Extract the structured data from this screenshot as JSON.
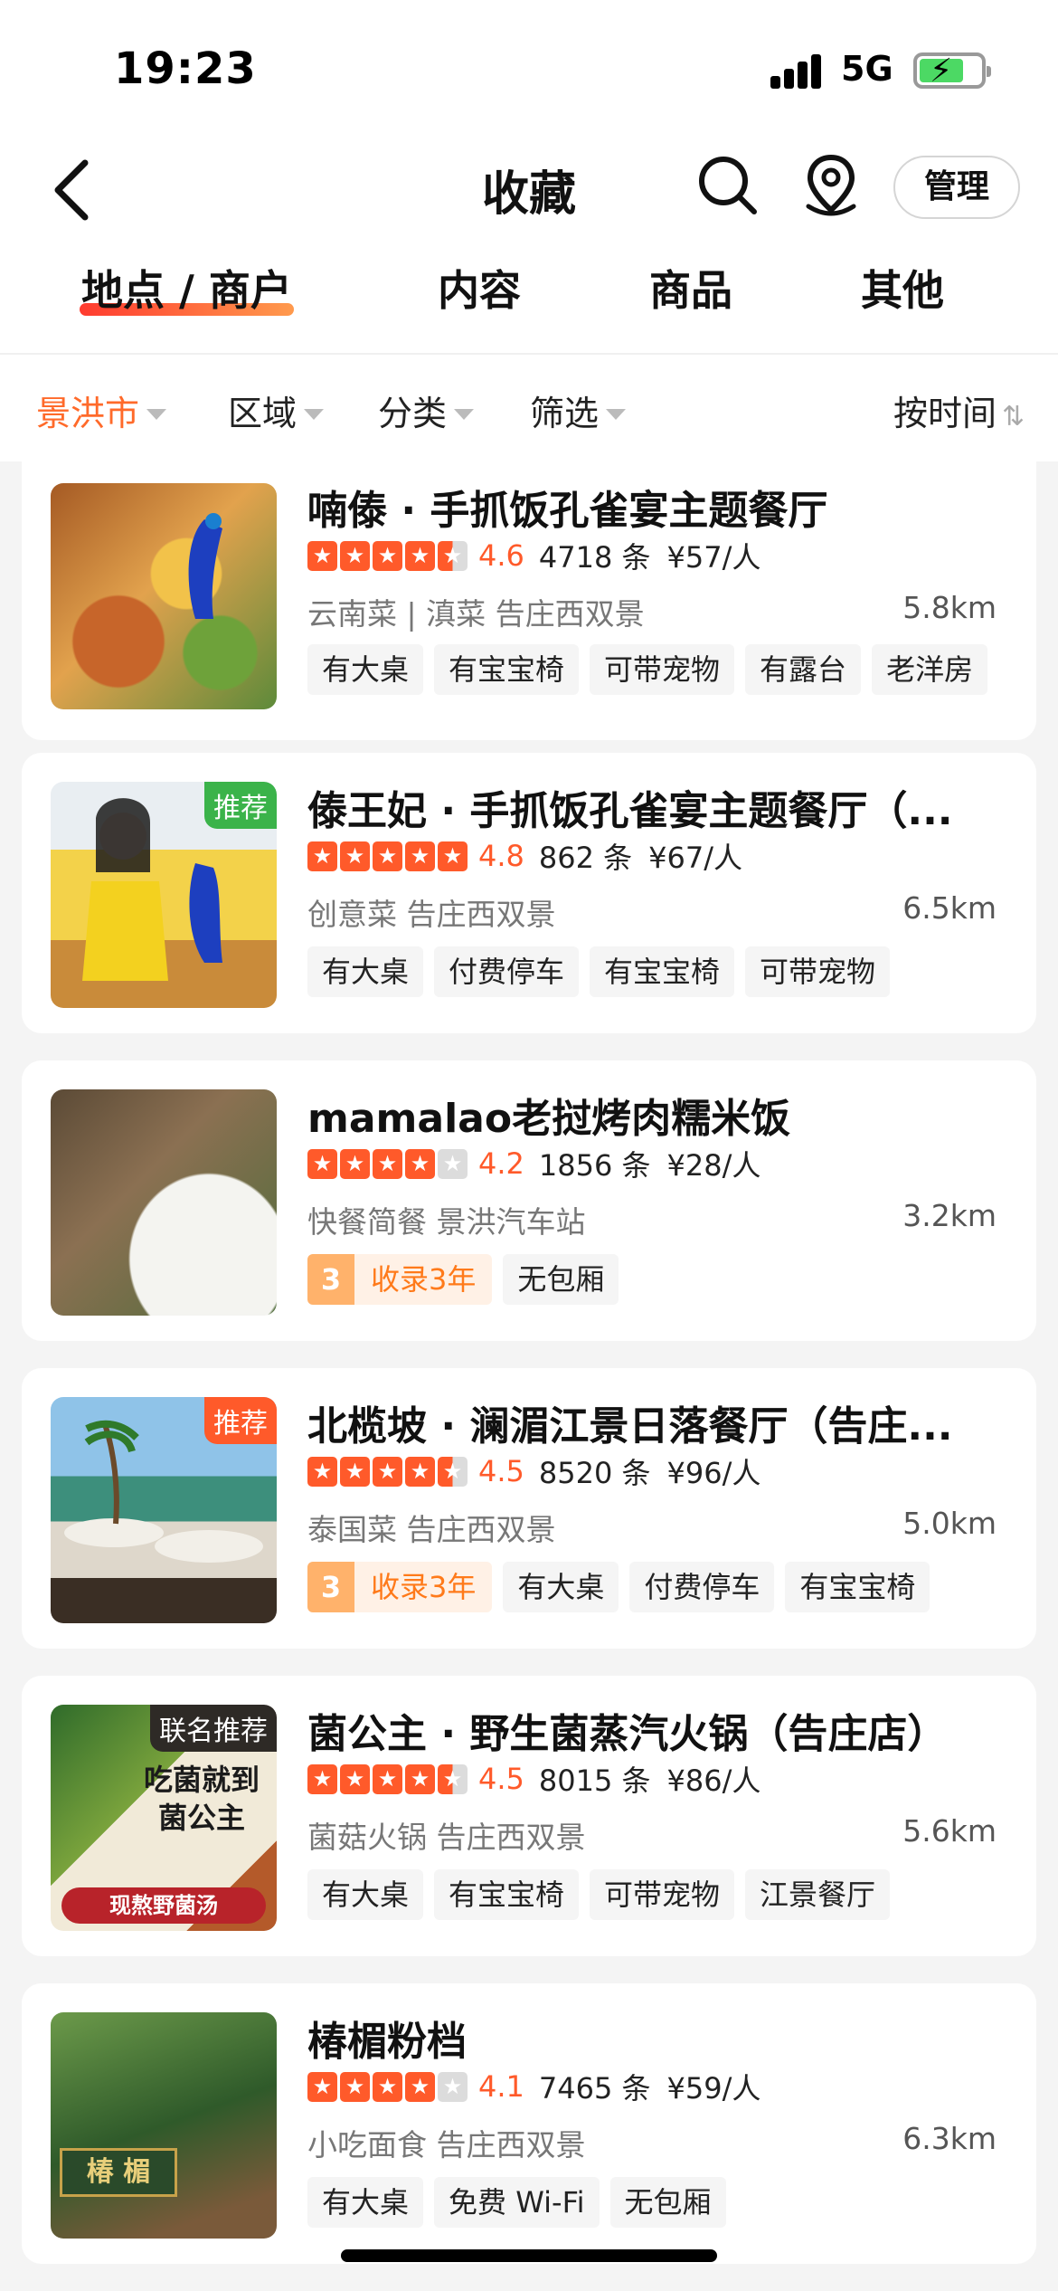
{
  "status_bar": {
    "time": "19:23",
    "network": "5G"
  },
  "nav": {
    "title": "收藏",
    "manage_label": "管理"
  },
  "tabs": [
    {
      "label": "地点 / 商户",
      "active": true
    },
    {
      "label": "内容",
      "active": false
    },
    {
      "label": "商品",
      "active": false
    },
    {
      "label": "其他",
      "active": false
    }
  ],
  "filters": {
    "city": "景洪市",
    "area": "区域",
    "category": "分类",
    "filter": "筛选",
    "sort": "按时间"
  },
  "colors": {
    "accent": "#ff5a2a",
    "tab_gradient_start": "#ff3b2f",
    "tab_gradient_end": "#ff9a4d",
    "record_orange": "#ff7a1a"
  },
  "items": [
    {
      "name": "喃傣 · 手抓饭孔雀宴主题餐厅",
      "stars": 4.5,
      "score": "4.6",
      "reviews": "4718 条",
      "price": "¥57/人",
      "category": "云南菜 | 滇菜  告庄西双景",
      "distance": "5.8km",
      "badge": "",
      "tags": [
        "有大桌",
        "有宝宝椅",
        "可带宠物",
        "有露台",
        "老洋房"
      ]
    },
    {
      "name": "傣王妃 · 手抓饭孔雀宴主题餐厅（...",
      "stars": 5,
      "score": "4.8",
      "reviews": "862 条",
      "price": "¥67/人",
      "category": "创意菜  告庄西双景",
      "distance": "6.5km",
      "badge": "推荐",
      "tags": [
        "有大桌",
        "付费停车",
        "有宝宝椅",
        "可带宠物"
      ]
    },
    {
      "name": "mamalao老挝烤肉糯米饭",
      "stars": 4,
      "score": "4.2",
      "reviews": "1856 条",
      "price": "¥28/人",
      "category": "快餐简餐  景洪汽车站",
      "distance": "3.2km",
      "badge": "",
      "record": {
        "num": "3",
        "text": "收录3年"
      },
      "tags": [
        "无包厢"
      ]
    },
    {
      "name": "北榄坡 · 澜湄江景日落餐厅（告庄...",
      "stars": 4.5,
      "score": "4.5",
      "reviews": "8520 条",
      "price": "¥96/人",
      "category": "泰国菜  告庄西双景",
      "distance": "5.0km",
      "badge": "推荐",
      "record": {
        "num": "3",
        "text": "收录3年"
      },
      "tags": [
        "有大桌",
        "付费停车",
        "有宝宝椅"
      ]
    },
    {
      "name": "菌公主 · 野生菌蒸汽火锅（告庄店）",
      "stars": 4.5,
      "score": "4.5",
      "reviews": "8015 条",
      "price": "¥86/人",
      "category": "菌菇火锅  告庄西双景",
      "distance": "5.6km",
      "badge": "联名推荐",
      "thumb_text": [
        "吃菌就到",
        "菌公主",
        "现熬野菌汤"
      ],
      "tags": [
        "有大桌",
        "有宝宝椅",
        "可带宠物",
        "江景餐厅"
      ]
    },
    {
      "name": "椿楣粉档",
      "stars": 4,
      "score": "4.1",
      "reviews": "7465 条",
      "price": "¥59/人",
      "category": "小吃面食  告庄西双景",
      "distance": "6.3km",
      "badge": "",
      "thumb_text": [
        "椿 楣"
      ],
      "tags": [
        "有大桌",
        "免费 Wi-Fi",
        "无包厢"
      ]
    }
  ]
}
